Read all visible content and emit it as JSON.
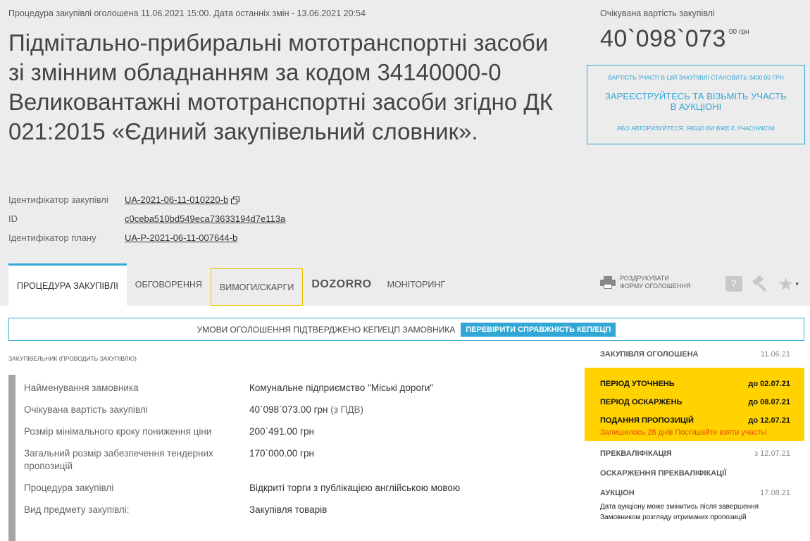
{
  "header": {
    "announce": "Процедура закупівлі оголошена 11.06.2021 15:00. Дата останніх змін - 13.06.2021 20:54",
    "title": "Підмітально-прибиральні мототранспортні засоби зі змінним обладнанням за кодом 34140000-0 Великовантажні мототранспортні засоби згідно ДК 021:2015 «Єдиний закупівельний словник»."
  },
  "identifiers": [
    {
      "label": "Ідентифікатор закупівлі",
      "value": "UA-2021-06-11-010220-b"
    },
    {
      "label": "ID",
      "value": "c0ceba510bd549eca73633194d7e113a"
    },
    {
      "label": "Ідентифікатор плану",
      "value": "UA-P-2021-06-11-007644-b"
    }
  ],
  "price": {
    "label": "Очікувана вартість закупівлі",
    "value": "40`098`073",
    "cents": "00 грн"
  },
  "participation": {
    "cost": "Вартість участі в цій закупівлі становить 3400.00 грн",
    "register": "Зареєструйтесь та візьміть участь в аукціоні",
    "login": "або авторизуйтеся, якщо ви вже є учасником"
  },
  "tabs": {
    "procedure": "Процедура закупівлі",
    "discussion": "Обговорення",
    "claims": "Вимоги/скарги",
    "dozorro": "DOZORRO",
    "monitoring": "Моніторинг"
  },
  "actions": {
    "print_line1": "Роздрукувати",
    "print_line2": "форму оголошення",
    "question_glyph": "?",
    "star_glyph": "★",
    "caret_glyph": "▾",
    "icons": [
      "printer-icon",
      "question-icon",
      "gavel-icon",
      "star-icon"
    ]
  },
  "ecp": {
    "text": "Умови оголошення підтверджено КЕП/ЕЦП замовника",
    "button": "Перевірити справжність КЕП/ЕЦП"
  },
  "buyer_heading": "Закупівельник (проводить закупівлю)",
  "info": [
    {
      "label": "Найменування замовника",
      "value": "Комунальне підприємство \"Міські дороги\"",
      "note": ""
    },
    {
      "label": "Очікувана вартість закупівлі",
      "value": "40`098`073.00 грн",
      "note": "(з ПДВ)"
    },
    {
      "label": "Розмір мінімального кроку пониження ціни",
      "value": "200`491.00 грн",
      "note": ""
    },
    {
      "label": "Загальний розмір забезпечення тендерних пропозицій",
      "value": "170`000.00 грн",
      "note": ""
    },
    {
      "label": "Процедура закупівлі",
      "value": "Відкриті торги з публікацією англійською мовою",
      "note": ""
    },
    {
      "label": "Вид предмету закупівлі:",
      "value": "Закупівля товарів",
      "note": ""
    }
  ],
  "timeline": {
    "announced": {
      "label": "Закупівля оголошена",
      "date": "11.06.21"
    },
    "highlight": [
      {
        "label": "Період уточнень",
        "date": "до 02.07.21"
      },
      {
        "label": "Період оскаржень",
        "date": "до 08.07.21"
      },
      {
        "label": "Подання пропозицій",
        "date": "до 12.07.21"
      }
    ],
    "warning": "Залишилось 28 днів Поспішайте взяти участь!",
    "prequalification": {
      "label": "Прекваліфікація",
      "date": "з 12.07.21"
    },
    "appeal": {
      "label": "Оскарження прекваліфікації"
    },
    "auction": {
      "label": "Аукціон",
      "date": "17.08.21"
    },
    "auction_note": "Дата аукціону може змінитись після завершення Замовником розгляду отриманих пропозицій"
  },
  "colors": {
    "accent": "#32a7d5",
    "highlight": "#ffd200",
    "warning": "#e04b00",
    "header_bg": "#ececec"
  }
}
